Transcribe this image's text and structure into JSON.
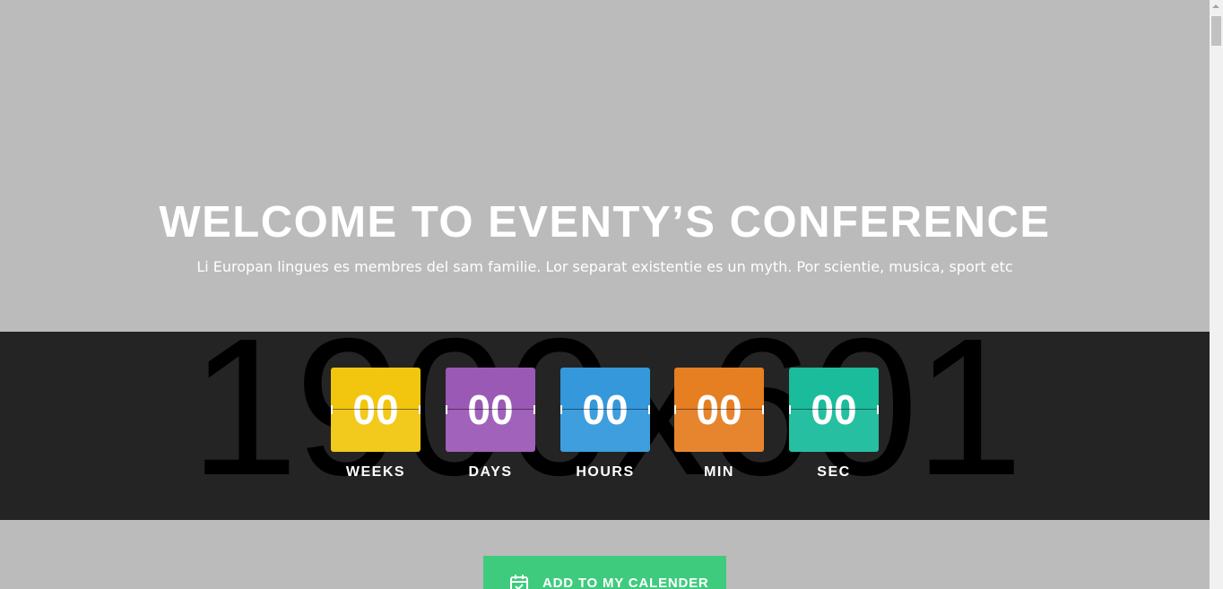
{
  "hero": {
    "title": "WELCOME TO EVENTY’S CONFERENCE",
    "subtitle": "Li Europan lingues es membres del sam familie. Lor separat existentie es un myth. Por scientie, musica, sport etc"
  },
  "countdown": {
    "background_text": "1900x601",
    "units": [
      {
        "value": "00",
        "label": "WEEKS",
        "color": "#f2c60f"
      },
      {
        "value": "00",
        "label": "DAYS",
        "color": "#9b59b6"
      },
      {
        "value": "00",
        "label": "HOURS",
        "color": "#3498db"
      },
      {
        "value": "00",
        "label": "MIN",
        "color": "#e67e22"
      },
      {
        "value": "00",
        "label": "SEC",
        "color": "#1abc9c"
      }
    ]
  },
  "cta": {
    "label": "ADD TO MY CALENDER",
    "icon": "calendar-check-icon",
    "color": "#3fcb7e"
  },
  "colors": {
    "hero_bg": "#bbbbbb",
    "band_bg": "#242424"
  }
}
